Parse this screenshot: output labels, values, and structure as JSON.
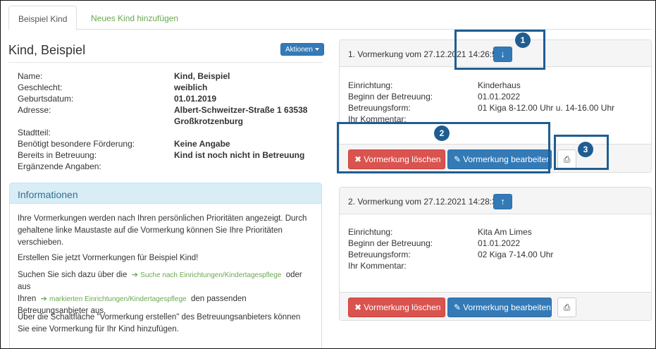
{
  "tabs": [
    {
      "label": "Beispiel Kind"
    },
    {
      "label": "Neues Kind hinzufügen"
    }
  ],
  "child": {
    "title": "Kind, Beispiel",
    "actions_label": "Aktionen"
  },
  "profile": {
    "labels": [
      "Name:",
      "Geschlecht:",
      "Geburtsdatum:",
      "Adresse:",
      "Stadtteil:",
      "Benötigt besondere Förderung:",
      "Bereits in Betreuung:",
      "Ergänzende Angaben:"
    ],
    "values": {
      "name": "Kind, Beispiel",
      "geschlecht": "weiblich",
      "geburtsdatum": "01.01.2019",
      "adresse_line1": "Albert-Schweitzer-Straße 1 63538",
      "adresse_line2": "Großkrotzenburg",
      "foerderung": "Keine Angabe",
      "betreuung": "Kind ist noch nicht in Betreuung"
    }
  },
  "info": {
    "heading": "Informationen",
    "p1": "Ihre Vormerkungen werden nach Ihren persönlichen Prioritäten angezeigt. Durch gehaltene linke Maustaste auf die Vormerkung können Sie Ihre Prioritäten verschieben.",
    "p2": "Erstellen Sie jetzt Vormerkungen für Beispiel Kind!",
    "p3_a": "Suchen Sie sich dazu über die",
    "p3_link1": "Suche nach Einrichtungen/Kindertagespflege",
    "p3_b": "oder aus",
    "p3_c": "Ihren",
    "p3_link2": "markierten Einrichtungen/Kindertagespflege",
    "p3_d": "den passenden Betreuungsanbieter aus.",
    "p4": "Über die Schaltfläche \"Vormerkung erstellen\" des Betreuungsanbieters können Sie eine Vormerkung für Ihr Kind hinzufügen."
  },
  "field_labels": {
    "einrichtung": "Einrichtung:",
    "beginn": "Beginn der Betreuung:",
    "form": "Betreuungsform:",
    "kommentar": "Ihr Kommentar:"
  },
  "buttons": {
    "delete": "Vormerkung löschen",
    "edit": "Vormerkung bearbeiten"
  },
  "reservations": [
    {
      "title": "1. Vormerkung vom 27.12.2021 14:26:52",
      "einrichtung": "Kinderhaus",
      "beginn": "01.01.2022",
      "form": "01 Kiga 8-12.00 Uhr u. 14-16.00 Uhr"
    },
    {
      "title": "2. Vormerkung vom 27.12.2021 14:28:34",
      "einrichtung": "Kita Am Limes",
      "beginn": "01.01.2022",
      "form": "02 Kiga 7-14.00 Uhr"
    }
  ],
  "callouts": [
    "1",
    "2",
    "3"
  ],
  "icons": {
    "arrow_down": "arrow-down-icon",
    "arrow_up": "arrow-up-icon",
    "times": "times-icon",
    "pencil": "pencil-icon",
    "print": "print-icon"
  },
  "colors": {
    "primary": "#337ab7",
    "danger": "#d9534f",
    "link_green": "#6aa84f",
    "info_bg": "#d9edf7",
    "callout": "#1f5d91"
  }
}
